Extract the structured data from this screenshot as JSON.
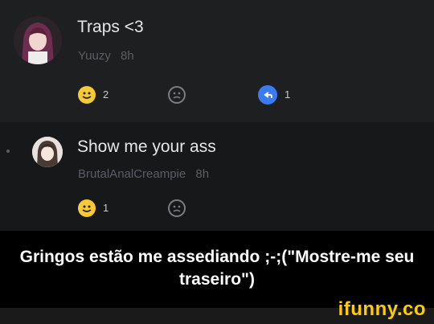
{
  "comments": [
    {
      "title": "Traps <3",
      "author": "Yuuzy",
      "time": "8h",
      "likes": "2",
      "replies": "1",
      "icons": [
        "avatar",
        "happy-face-icon",
        "sad-face-icon",
        "reply-bubble-icon"
      ]
    },
    {
      "title": "Show me your ass",
      "author": "BrutalAnalCreampie",
      "time": "8h",
      "likes": "1",
      "icons": [
        "avatar",
        "happy-face-icon",
        "sad-face-icon"
      ]
    }
  ],
  "caption": "Gringos estão me assediando ;-;(\"Mostre-me seu traseiro\")",
  "watermark": "ifunny.co",
  "colors": {
    "accent_blue": "#3a7bf0",
    "emoji_yellow": "#f7c934",
    "watermark_yellow": "#ffcc00"
  }
}
